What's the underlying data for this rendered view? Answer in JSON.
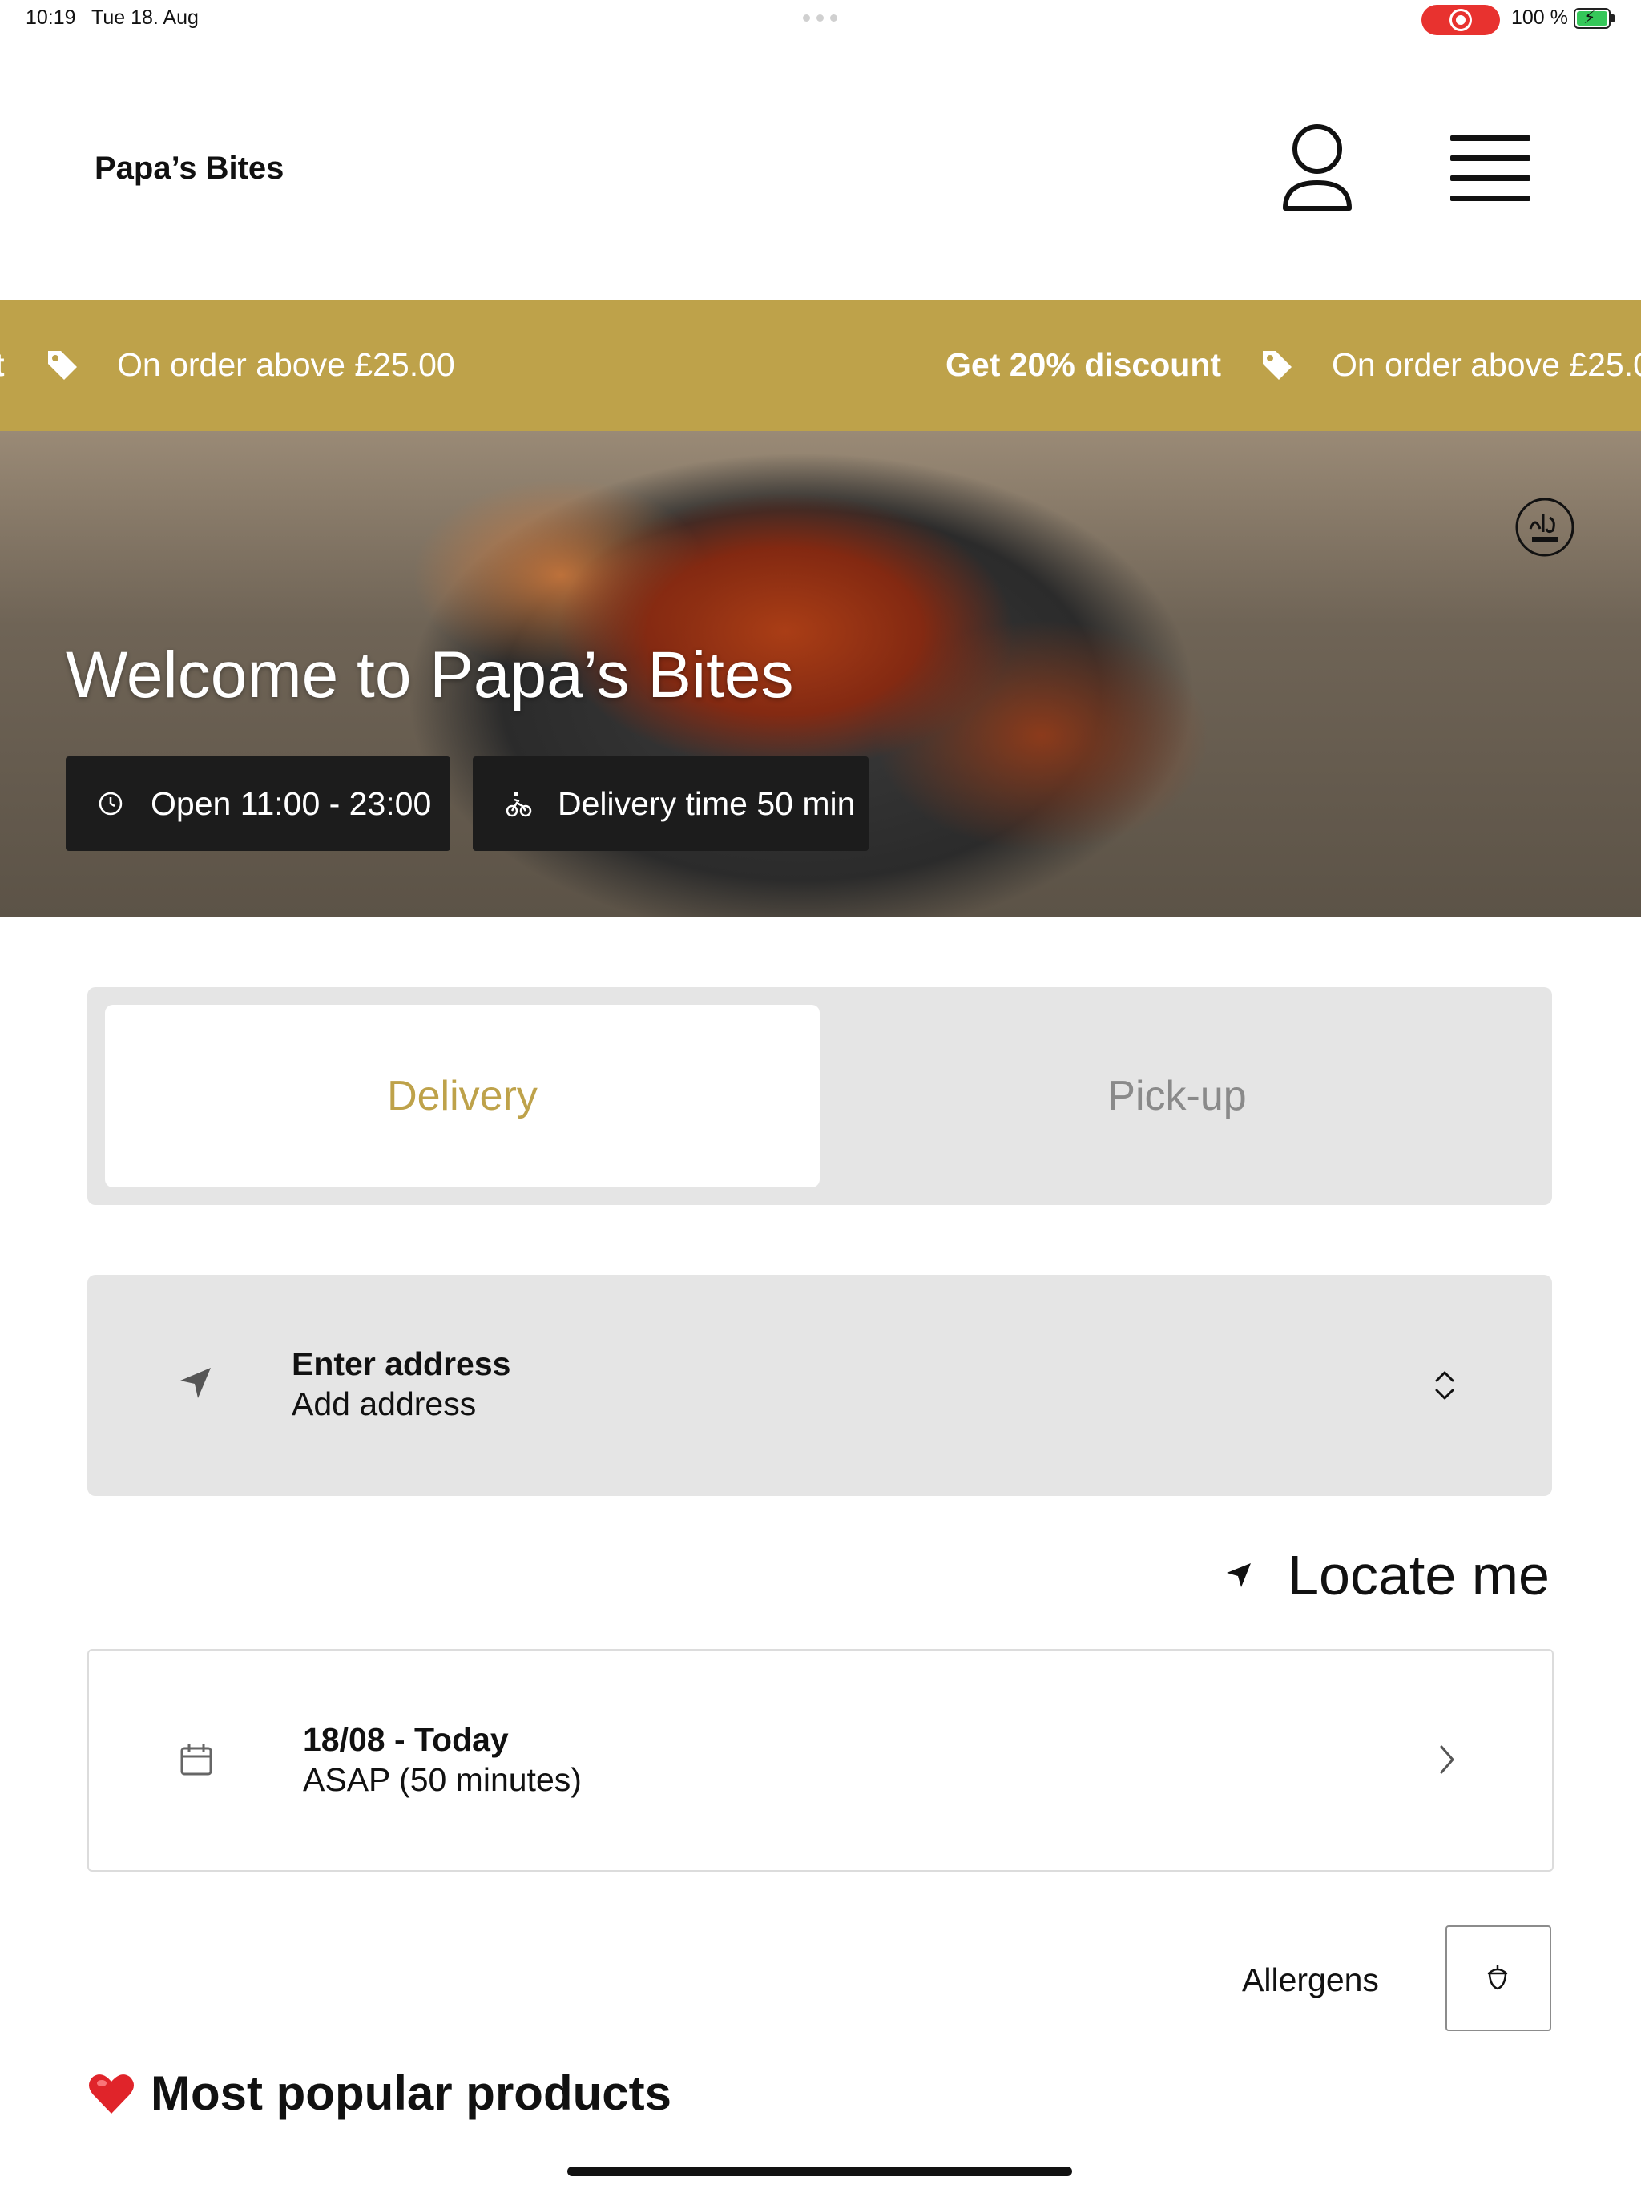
{
  "status_bar": {
    "time": "10:19",
    "date": "Tue 18. Aug",
    "battery": "100 %"
  },
  "header": {
    "brand": "Papa’s Bites"
  },
  "promo": {
    "left_partial": "t",
    "condition_1": "On order above £25.00",
    "discount": "Get 20% discount",
    "condition_2": "On order above £25.0"
  },
  "hero": {
    "title": "Welcome to Papa’s Bites",
    "open_hours": "Open 11:00 - 23:00",
    "delivery_time": "Delivery time 50 min"
  },
  "order_mode": {
    "options": [
      "Delivery",
      "Pick-up"
    ],
    "selected": "Delivery"
  },
  "address": {
    "title": "Enter address",
    "subtitle": "Add address"
  },
  "locate": {
    "label": "Locate me"
  },
  "schedule": {
    "date": "18/08 - Today",
    "time": "ASAP (50 minutes)"
  },
  "allergens": {
    "label": "Allergens"
  },
  "popular": {
    "emoji": "❤️",
    "title": "Most popular products"
  },
  "colors": {
    "accent_gold": "#bea24a",
    "chip_dark": "#1c1c1c",
    "panel_grey": "#e5e5e5",
    "recording_red": "#e8322f"
  }
}
